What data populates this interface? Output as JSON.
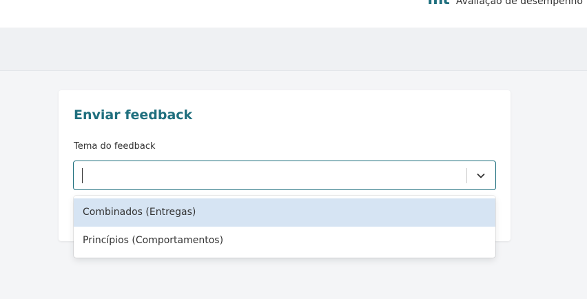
{
  "header": {
    "brand_mark": "mt",
    "brand_text": "Avaliação de desempenho"
  },
  "form": {
    "title": "Enviar feedback",
    "field_label": "Tema do feedback",
    "input_value": "",
    "options": [
      {
        "label": "Combinados (Entregas)",
        "focused": true
      },
      {
        "label": "Princípios (Comportamentos)",
        "focused": false
      }
    ]
  },
  "colors": {
    "accent": "#1f6f7e",
    "option_focus": "#d6e4f3",
    "page_bg": "#f4f5f7"
  },
  "icons": {
    "dropdown": "chevron-down-icon"
  }
}
